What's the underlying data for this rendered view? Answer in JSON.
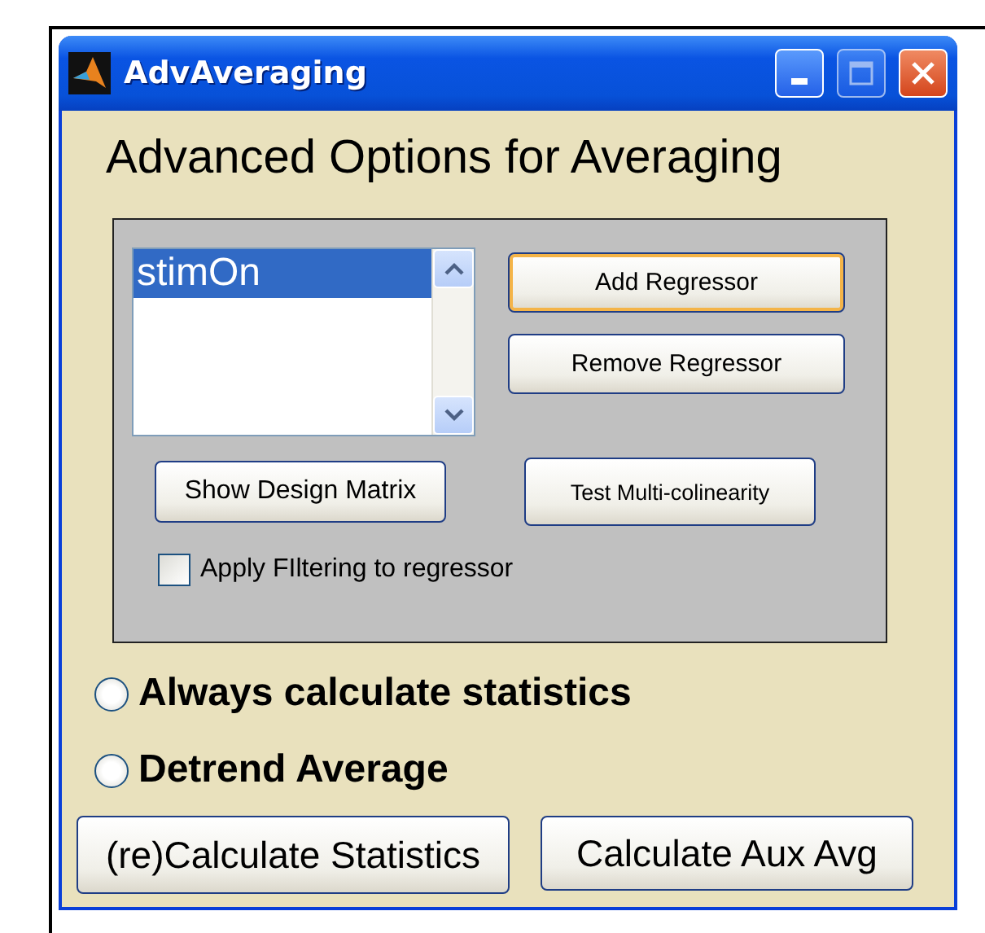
{
  "window": {
    "title": "AdvAveraging"
  },
  "heading": "Advanced Options for Averaging",
  "regressor_list": {
    "items": [
      {
        "label": "stimOn",
        "selected": true
      }
    ]
  },
  "regressor_buttons": [
    {
      "label": "Add Regressor",
      "focused": true
    },
    {
      "label": "Remove Regressor",
      "focused": false
    }
  ],
  "panel_buttons": [
    {
      "label": "Show Design Matrix"
    },
    {
      "label": "Test Multi-colinearity"
    }
  ],
  "filter_checkbox": {
    "label": "Apply FIltering to regressor",
    "checked": false
  },
  "options": [
    {
      "label": "Always calculate statistics",
      "selected": false
    },
    {
      "label": "Detrend Average",
      "selected": false
    }
  ],
  "buttons": [
    {
      "label": "(re)Calculate Statistics"
    },
    {
      "label": "Calculate Aux Avg"
    }
  ]
}
